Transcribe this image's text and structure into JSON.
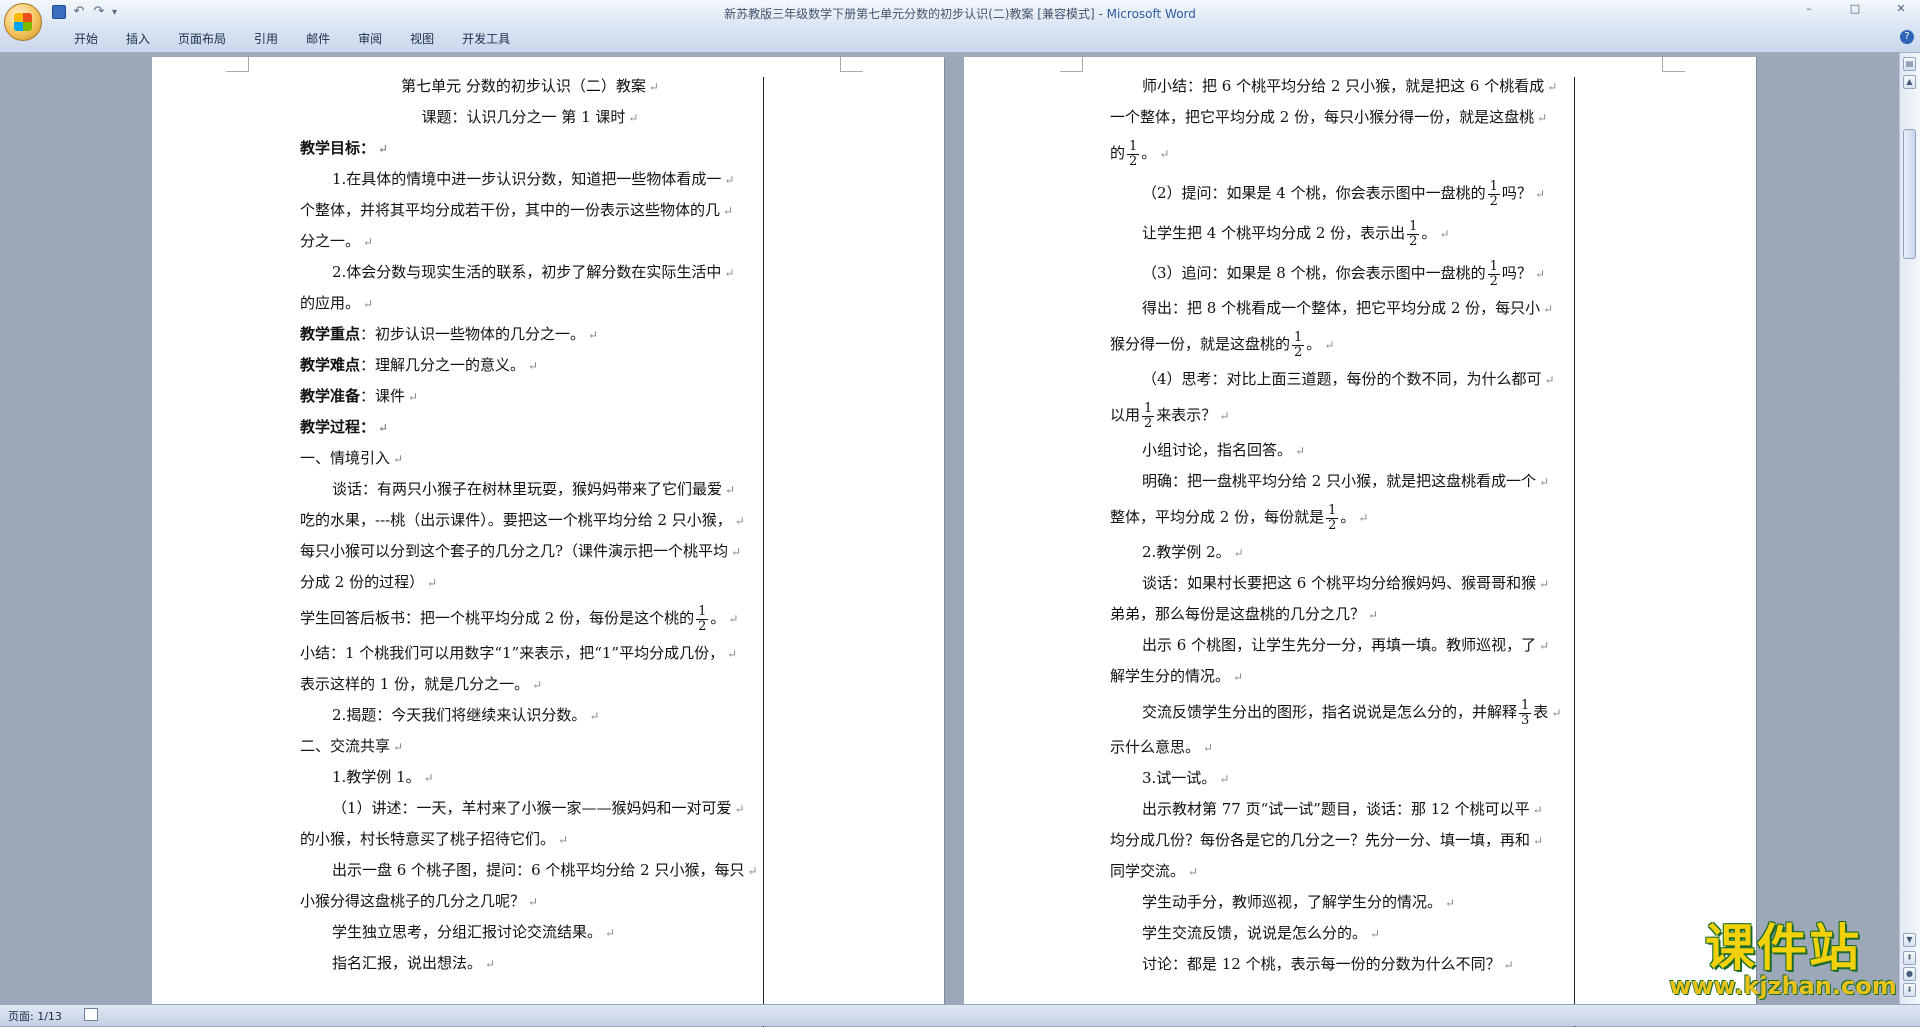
{
  "window": {
    "title": "新苏教版三年级数学下册第七单元分数的初步认识(二)教案 [兼容模式]",
    "app_name": "Microsoft Word",
    "controls": [
      "–",
      "□",
      "✕"
    ]
  },
  "quick_access": {
    "more": "▾"
  },
  "ribbon": {
    "tabs": [
      "开始",
      "插入",
      "页面布局",
      "引用",
      "邮件",
      "审阅",
      "视图",
      "开发工具"
    ],
    "help": "?"
  },
  "page1": {
    "lines": [
      {
        "text": "第七单元   分数的初步认识（二）教案"
      },
      {
        "text": "课题：认识几分之一    第 1 课时"
      },
      {
        "text": "教学目标："
      },
      {
        "text": "1.在具体的情境中进一步认识分数，知道把一些物体看成一"
      },
      {
        "text": "个整体，并将其平均分成若干份，其中的一份表示这些物体的几"
      },
      {
        "text": "分之一。"
      },
      {
        "text": "2.体会分数与现实生活的联系，初步了解分数在实际生活中"
      },
      {
        "text": "的应用。"
      },
      {
        "label": "教学重点",
        "text": "：初步认识一些物体的几分之一。"
      },
      {
        "label": "教学难点",
        "text": "：理解几分之一的意义。"
      },
      {
        "label": "教学准备",
        "text": "：课件"
      },
      {
        "text": "教学过程："
      },
      {
        "text": "一、情境引入"
      },
      {
        "text": "谈话：有两只小猴子在树林里玩耍，猴妈妈带来了它们最爱"
      },
      {
        "text": "吃的水果，---桃（出示课件）。要把这一个桃平均分给 2 只小猴，"
      },
      {
        "text": "每只小猴可以分到这个套子的几分之几?（课件演示把一个桃平均"
      },
      {
        "text": "分成 2 份的过程）"
      },
      {
        "text": "学生回答后板书：把一个桃平均分成 2 份，每份是这个桃的",
        "frac": [
          "1",
          "2"
        ],
        "after": "。"
      },
      {
        "text": "小结：1 个桃我们可以用数字“1”来表示，把“1”平均分成几份，"
      },
      {
        "text": "表示这样的 1 份，就是几分之一。"
      },
      {
        "text": "2.揭题：今天我们将继续来认识分数。"
      },
      {
        "text": "二、交流共享"
      },
      {
        "text": "1.教学例 1。"
      },
      {
        "text": "（1）讲述：一天，羊村来了小猴一家——猴妈妈和一对可爱"
      },
      {
        "text": "的小猴，村长特意买了桃子招待它们。"
      },
      {
        "text": "出示一盘 6 个桃子图，提问：6 个桃平均分给 2 只小猴，每只"
      },
      {
        "text": "小猴分得这盘桃子的几分之几呢？"
      },
      {
        "text": "学生独立思考，分组汇报讨论交流结果。"
      },
      {
        "text": "指名汇报，说出想法。"
      }
    ]
  },
  "page2": {
    "lines": [
      {
        "text": "师小结：把 6 个桃平均分给 2 只小猴，就是把这 6 个桃看成"
      },
      {
        "text": "一个整体，把它平均分成 2 份，每只小猴分得一份，就是这盘桃"
      },
      {
        "text": "的",
        "frac": [
          "1",
          "2"
        ],
        "after": "。"
      },
      {
        "text": "（2）提问：如果是 4 个桃，你会表示图中一盘桃的",
        "frac": [
          "1",
          "2"
        ],
        "after": "吗？"
      },
      {
        "text": "让学生把 4 个桃平均分成 2 份，表示出",
        "frac": [
          "1",
          "2"
        ],
        "after": "。"
      },
      {
        "text": "（3）追问：如果是 8 个桃，你会表示图中一盘桃的",
        "frac": [
          "1",
          "2"
        ],
        "after": "吗？"
      },
      {
        "text": "得出：把 8 个桃看成一个整体，把它平均分成 2 份，每只小"
      },
      {
        "text": "猴分得一份，就是这盘桃的",
        "frac": [
          "1",
          "2"
        ],
        "after": "。"
      },
      {
        "text": "（4）思考：对比上面三道题，每份的个数不同，为什么都可"
      },
      {
        "text": "以用",
        "frac": [
          "1",
          "2"
        ],
        "after": "来表示？"
      },
      {
        "text": "小组讨论，指名回答。"
      },
      {
        "text": "明确：把一盘桃平均分给 2 只小猴，就是把这盘桃看成一个"
      },
      {
        "text": "整体，平均分成 2 份，每份就是",
        "frac": [
          "1",
          "2"
        ],
        "after": "。"
      },
      {
        "text": "2.教学例 2。"
      },
      {
        "text": "谈话：如果村长要把这 6 个桃平均分给猴妈妈、猴哥哥和猴"
      },
      {
        "text": "弟弟，那么每份是这盘桃的几分之几？"
      },
      {
        "text": "出示 6 个桃图，让学生先分一分，再填一填。教师巡视，了"
      },
      {
        "text": "解学生分的情况。"
      },
      {
        "text": "交流反馈学生分出的图形，指名说说是怎么分的，并解释",
        "frac": [
          "1",
          "3"
        ],
        "after": "表"
      },
      {
        "text": "示什么意思。"
      },
      {
        "text": "3.试一试。"
      },
      {
        "text": "出示教材第 77 页“试一试”题目，谈话：那 12 个桃可以平"
      },
      {
        "text": "均分成几份？每份各是它的几分之一？先分一分、填一填，再和"
      },
      {
        "text": "同学交流。"
      },
      {
        "text": "学生动手分，教师巡视，了解学生分的情况。"
      },
      {
        "text": "学生交流反馈，说说是怎么分的。"
      },
      {
        "text": "讨论：都是 12 个桃，表示每一份的分数为什么不同？"
      }
    ]
  },
  "pilcrow": "↵",
  "statusbar": {
    "page_info": "页面: 1/13"
  },
  "watermark": {
    "top": "课件站",
    "bottom": "www.kjzhan.com"
  }
}
